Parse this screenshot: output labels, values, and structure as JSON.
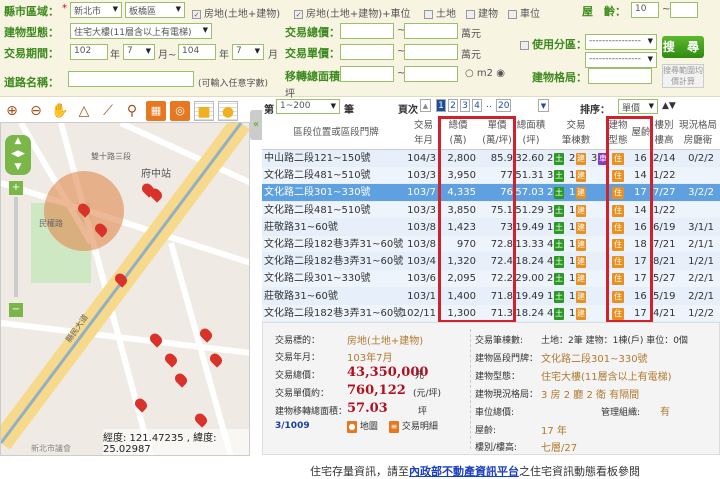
{
  "form": {
    "city_label": "縣市區域：",
    "city": "新北市",
    "district": "板橋區",
    "checks": [
      {
        "label": "房地(土地+建物)",
        "checked": true
      },
      {
        "label": "房地(土地+建物)+車位",
        "checked": true
      },
      {
        "label": "土地",
        "checked": false
      },
      {
        "label": "建物",
        "checked": false
      },
      {
        "label": "車位",
        "checked": false
      }
    ],
    "age_label": "屋　齡：",
    "age_from": "10",
    "age_to": "",
    "type_label": "建物型態：",
    "type": "住宅大樓(11層含以上有電梯)",
    "total_label": "交易總價：",
    "unit_label": "交易單價：",
    "area_label": "移轉總面積：",
    "wan": "萬元",
    "ping": "坪",
    "m2": "m2",
    "period_label": "交易期間：",
    "year_from": "102",
    "month_from": "7",
    "year_to": "104",
    "month_to": "7",
    "year": "年",
    "month": "月",
    "month_tilde": "月~",
    "tilde": "~",
    "zone_label": "使用分區：",
    "zone1": "----------------",
    "zone2": "----------------",
    "layout_label": "建物格局：",
    "road_label": "道路名稱：",
    "road_hint": "(可輸入任意字數)",
    "search": "搜 尋",
    "avg": "搜尋範圍均價計算"
  },
  "map": {
    "coords": "經度: 121.47235 , 緯度: 25.02987",
    "labels": [
      "新北市議會",
      "府中站",
      "縣民大道",
      "民權路",
      "雙十路三段"
    ]
  },
  "table": {
    "range_label": "第",
    "range": "1~200",
    "range_suffix": "筆",
    "page_label": "頁次",
    "pages": [
      "1",
      "2",
      "3",
      "4",
      "..",
      "20"
    ],
    "sort_label": "排序：",
    "sort": "單價",
    "headers": [
      "區段位置或區段門牌",
      "交易\n年月",
      "總價\n(萬)",
      "單價\n(萬/坪)",
      "總面積\n(坪)",
      "交易\n筆棟數",
      "建物\n型態",
      "屋齡",
      "樓別\n樓高",
      "現況格局\n房廳衛"
    ],
    "rows": [
      [
        "中山路二段121~150號",
        "104/3",
        "2,800",
        "85.9",
        "32.60",
        "2",
        "2",
        "3",
        "住",
        "16",
        "2/14",
        "0/2/2"
      ],
      [
        "文化路二段481~510號",
        "103/3",
        "3,950",
        "77",
        "51.31",
        "3",
        "1",
        "",
        "住",
        "14",
        "1/22",
        ""
      ],
      [
        "文化路二段301~330號",
        "103/7",
        "4,335",
        "76",
        "57.03",
        "2",
        "1",
        "",
        "住",
        "17",
        "7/27",
        "3/2/2"
      ],
      [
        "文化路二段481~510號",
        "103/3",
        "3,850",
        "75.1",
        "51.29",
        "3",
        "1",
        "",
        "住",
        "14",
        "1/22",
        ""
      ],
      [
        "莊敬路31~60號",
        "103/8",
        "1,423",
        "73",
        "19.49",
        "1",
        "1",
        "",
        "住",
        "16",
        "6/19",
        "3/1/1"
      ],
      [
        "文化路二段182巷3弄31~60號",
        "103/8",
        "970",
        "72.8",
        "13.33",
        "4",
        "1",
        "",
        "住",
        "18",
        "7/21",
        "2/1/1"
      ],
      [
        "文化路二段182巷3弄31~60號",
        "103/4",
        "1,320",
        "72.4",
        "18.24",
        "4",
        "1",
        "",
        "住",
        "17",
        "8/21",
        "1/2/1"
      ],
      [
        "文化路二段301~330號",
        "103/6",
        "2,095",
        "72.2",
        "29.00",
        "2",
        "1",
        "",
        "住",
        "17",
        "5/27",
        "2/2/1"
      ],
      [
        "莊敬路31~60號",
        "103/1",
        "1,400",
        "71.8",
        "19.49",
        "1",
        "1",
        "",
        "住",
        "16",
        "5/19",
        "2/2/1"
      ],
      [
        "文化路二段182巷3弄31~60號",
        "102/11",
        "1,300",
        "71.3",
        "18.24",
        "4",
        "1",
        "",
        "住",
        "17",
        "4/21",
        "1/2/2"
      ]
    ],
    "badges": {
      "land": "土",
      "bldg": "建",
      "park": "車"
    }
  },
  "detail": {
    "target_l": "交易標的：",
    "target": "房地(土地+建物)",
    "ym_l": "交易年月：",
    "ym": "103年7月",
    "total_l": "交易總價：",
    "total": "43,350,000",
    "total_u": "元",
    "unit_l": "交易單價約：",
    "unit": "760,122",
    "unit_u": "(元/坪)",
    "area_l": "建物移轉總面積：",
    "area": "57.03",
    "area_u": "坪",
    "index": "3/1009",
    "map_btn": "地圖",
    "detail_btn": "交易明細",
    "count_l": "交易筆棟數:",
    "count": "土地：2筆 建物：1棟(戶) 車位：0個",
    "addr_l": "建物區段門牌：",
    "addr": "文化路二段301~330號",
    "type_l": "建物型態：",
    "type": "住宅大樓(11層含以上有電梯)",
    "layout_l": "建物現況格局：",
    "layout": "3 房 2 廳 2 衛 有隔間",
    "park_l": "車位總價:",
    "mgmt_l": "管理組織:",
    "mgmt": "有",
    "age_l": "屋齡:",
    "age": "17 年",
    "floor_l": "樓別/樓高:",
    "floor": "七層/27"
  },
  "footer": {
    "pre": "住宅存量資訊，請至",
    "link": "內政部不動產資訊平台",
    "post": "之住宅資訊動態看板參閱"
  }
}
